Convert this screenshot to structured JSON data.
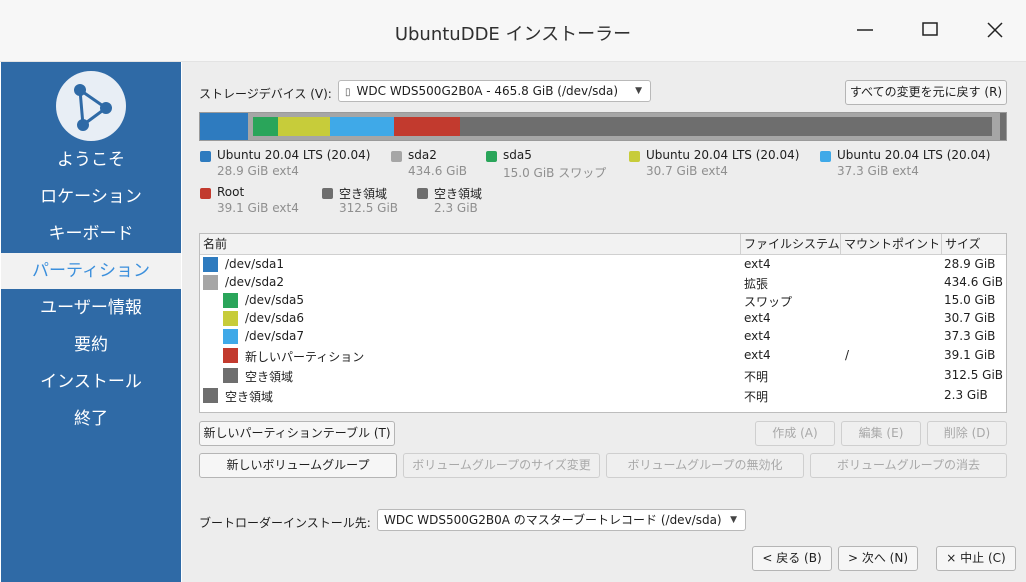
{
  "window": {
    "title": "UbuntuDDE インストーラー"
  },
  "sidebar": {
    "items": [
      {
        "label": "ようこそ"
      },
      {
        "label": "ロケーション"
      },
      {
        "label": "キーボード"
      },
      {
        "label": "パーティション"
      },
      {
        "label": "ユーザー情報"
      },
      {
        "label": "要約"
      },
      {
        "label": "インストール"
      },
      {
        "label": "終了"
      }
    ],
    "active_index": 3
  },
  "storage": {
    "label": "ストレージデバイス (V):",
    "device": "WDC WDS500G2B0A - 465.8 GiB (/dev/sda)",
    "revert_button": "すべての変更を元に戻す (R)"
  },
  "partition_bar": {
    "segments": [
      {
        "color": "#2e7bbf",
        "size_gib": 28.9
      },
      {
        "color": "#a6a6a6",
        "size_gib": 0
      },
      {
        "color": "#2aa55a",
        "size_gib": 15.0
      },
      {
        "color": "#c7cc3a",
        "size_gib": 30.7
      },
      {
        "color": "#3fa9e8",
        "size_gib": 37.3
      },
      {
        "color": "#c23a2e",
        "size_gib": 39.1
      },
      {
        "color": "#6e6e6e",
        "size_gib": 312.5
      }
    ]
  },
  "legend": [
    {
      "name": "Ubuntu 20.04 LTS (20.04)",
      "size": "28.9 GiB  ext4",
      "color": "#2e7bbf"
    },
    {
      "name": "sda2",
      "size": "434.6 GiB",
      "color": "#a6a6a6"
    },
    {
      "name": "sda5",
      "size": "15.0 GiB  スワップ",
      "color": "#2aa55a"
    },
    {
      "name": "Ubuntu 20.04 LTS (20.04)",
      "size": "30.7 GiB  ext4",
      "color": "#c7cc3a"
    },
    {
      "name": "Ubuntu 20.04 LTS (20.04)",
      "size": "37.3 GiB  ext4",
      "color": "#3fa9e8"
    },
    {
      "name": "Root",
      "size": "39.1 GiB  ext4",
      "color": "#c23a2e"
    },
    {
      "name": "空き領域",
      "size": "312.5 GiB",
      "color": "#6e6e6e"
    },
    {
      "name": "空き領域",
      "size": "2.3 GiB",
      "color": "#6e6e6e"
    }
  ],
  "table": {
    "headers": [
      "名前",
      "ファイルシステム",
      "マウントポイント",
      "サイズ"
    ],
    "rows": [
      {
        "name": "/dev/sda1",
        "fs": "ext4",
        "mount": "",
        "size": "28.9 GiB",
        "color": "#2e7bbf"
      },
      {
        "name": "/dev/sda2",
        "fs": "拡張",
        "mount": "",
        "size": "434.6 GiB",
        "color": "#a6a6a6"
      },
      {
        "name": "/dev/sda5",
        "fs": "スワップ",
        "mount": "",
        "size": "15.0 GiB",
        "color": "#2aa55a"
      },
      {
        "name": "/dev/sda6",
        "fs": "ext4",
        "mount": "",
        "size": "30.7 GiB",
        "color": "#c7cc3a"
      },
      {
        "name": "/dev/sda7",
        "fs": "ext4",
        "mount": "",
        "size": "37.3 GiB",
        "color": "#3fa9e8"
      },
      {
        "name": "新しいパーティション",
        "fs": "ext4",
        "mount": "/",
        "size": "39.1 GiB",
        "color": "#c23a2e"
      },
      {
        "name": "空き領域",
        "fs": "不明",
        "mount": "",
        "size": "312.5 GiB",
        "color": "#6e6e6e"
      },
      {
        "name": "空き領域",
        "fs": "不明",
        "mount": "",
        "size": "2.3 GiB",
        "color": "#6e6e6e"
      }
    ]
  },
  "buttons": {
    "new_table": "新しいパーティションテーブル (T)",
    "create": "作成 (A)",
    "edit": "編集 (E)",
    "delete": "削除 (D)",
    "new_vg": "新しいボリュームグループ",
    "resize_vg": "ボリュームグループのサイズ変更",
    "deactivate_vg": "ボリュームグループの無効化",
    "remove_vg": "ボリュームグループの消去"
  },
  "bootloader": {
    "label": "ブートローダーインストール先:",
    "value": "WDC WDS500G2B0A のマスターブートレコード (/dev/sda)"
  },
  "footer": {
    "back": "戻る (B)",
    "next": "次へ (N)",
    "cancel": "中止 (C)"
  },
  "icons": [
    "app-logo-icon",
    "minimize-icon",
    "maximize-icon",
    "close-icon",
    "drive-icon",
    "chevron-down-icon",
    "chevron-left-icon",
    "chevron-right-icon",
    "cancel-x-icon"
  ]
}
